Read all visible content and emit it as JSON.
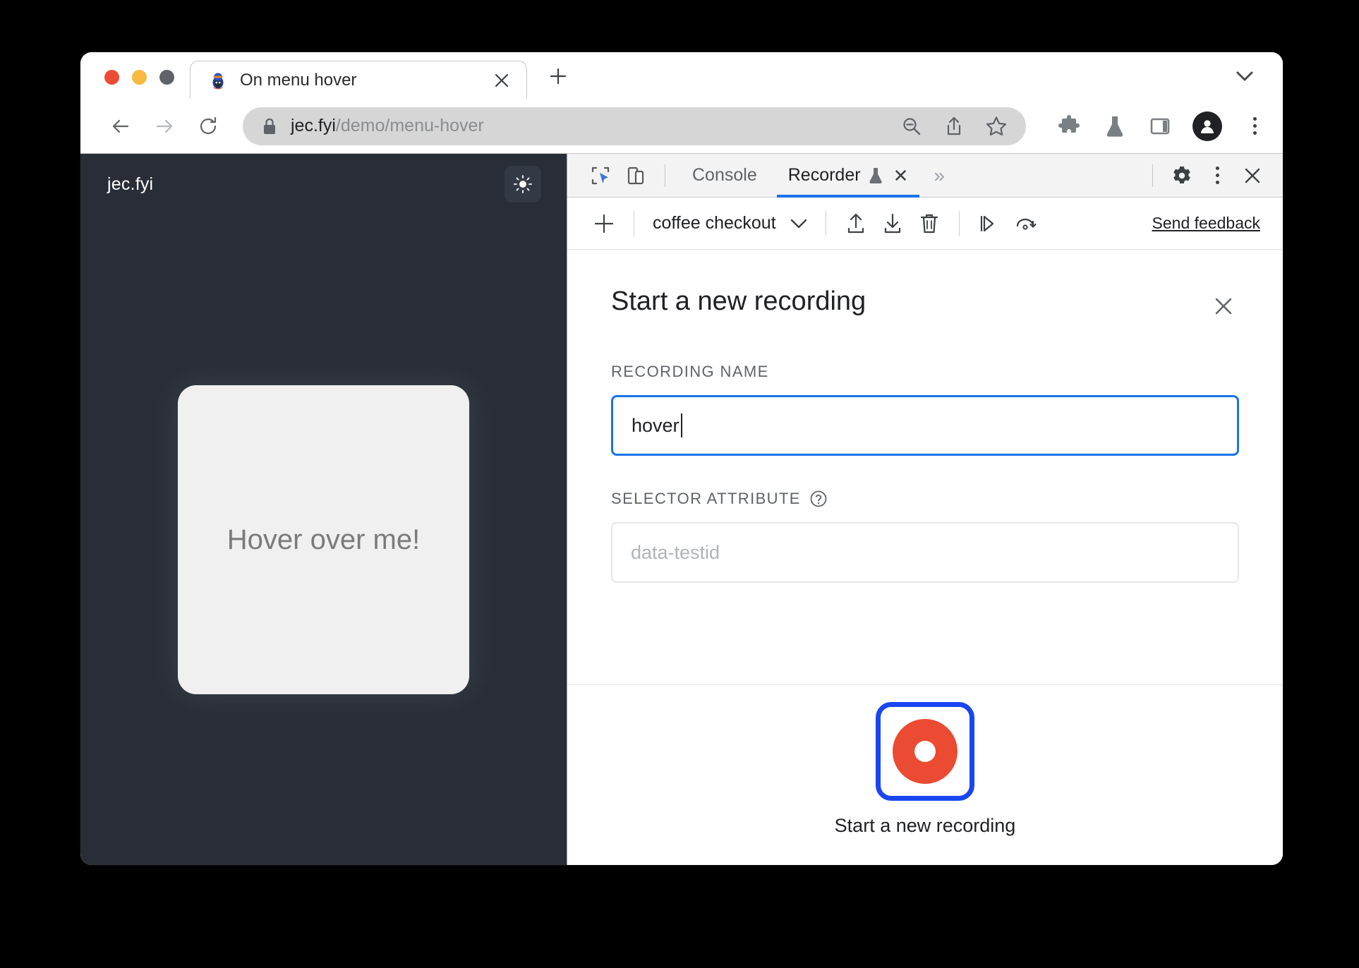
{
  "browser": {
    "traffic_lights": [
      "close",
      "minimize",
      "zoom"
    ],
    "tab": {
      "favicon": "penguin-favicon",
      "title": "On menu hover",
      "close_label": "✕"
    },
    "new_tab_label": "+",
    "tab_list_chevron": "chevron-down-icon",
    "nav": {
      "back": "back-arrow-icon",
      "forward": "forward-arrow-icon",
      "reload": "reload-icon"
    },
    "omnibox": {
      "lock": "lock-icon",
      "url_host": "jec.fyi",
      "url_path": "/demo/menu-hover",
      "actions": [
        "zoom-out-icon",
        "share-icon",
        "bookmark-star-icon"
      ]
    },
    "toolbar_icons": [
      "extensions-puzzle-icon",
      "experiments-flask-icon",
      "side-panel-icon",
      "profile-avatar",
      "browser-menu-icon"
    ]
  },
  "page": {
    "brand": "jec.fyi",
    "theme_toggle": "sun-icon",
    "hover_card_text": "Hover over me!"
  },
  "devtools": {
    "toolbar_left": [
      "inspect-element-icon",
      "device-toolbar-icon"
    ],
    "tabs": [
      {
        "label": "Console",
        "active": false
      },
      {
        "label": "Recorder",
        "active": true,
        "experimental": true,
        "close": "✕"
      }
    ],
    "more_tabs": "»",
    "toolbar_right": [
      "settings-gear-icon",
      "more-options-icon",
      "close-devtools-icon"
    ]
  },
  "recorder": {
    "toolbar": {
      "add_label": "+",
      "current_recording": "coffee checkout",
      "dropdown": "chevron-down-icon",
      "actions": [
        "export-icon",
        "import-icon",
        "delete-icon",
        "replay-step-icon",
        "re-record-icon"
      ],
      "feedback_label": "Send feedback"
    },
    "panel": {
      "title": "Start a new recording",
      "close_label": "✕",
      "recording_name": {
        "label": "RECORDING NAME",
        "value": "hover",
        "placeholder": ""
      },
      "selector_attribute": {
        "label": "SELECTOR ATTRIBUTE",
        "help": "help-icon",
        "value": "",
        "placeholder": "data-testid"
      },
      "start_button": {
        "icon": "record-circle-icon",
        "label": "Start a new recording"
      }
    }
  },
  "colors": {
    "accent_blue": "#1a73e8",
    "focus_blue": "#1a46f0",
    "record_red": "#eb4b32",
    "site_dark": "#282d37",
    "card_grey": "#f0f0f0"
  }
}
